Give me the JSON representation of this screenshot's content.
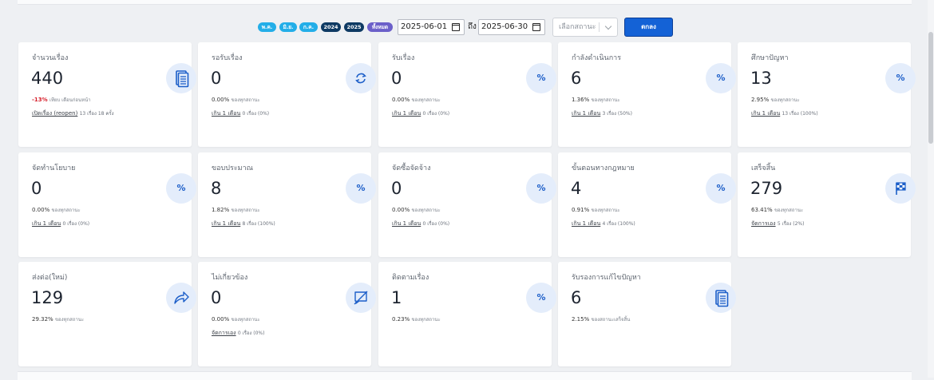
{
  "filters": {
    "pills": [
      {
        "label": "พ.ค.",
        "color": "#23aee8"
      },
      {
        "label": "มิ.ย.",
        "color": "#23aee8"
      },
      {
        "label": "ก.ค.",
        "color": "#23aee8"
      },
      {
        "label": "2024",
        "color": "#0e3a63"
      },
      {
        "label": "2025",
        "color": "#0e3a63"
      },
      {
        "label": "ทั้งหมด",
        "color": "#6b5fc9"
      }
    ],
    "start_date": "2025-06-01",
    "to_label": "ถึง",
    "end_date": "2025-06-30",
    "status_placeholder": "เลือกสถานะ",
    "ok_label": "ตกลง"
  },
  "cards": [
    {
      "title": "จำนวนเรื่อง",
      "value": "440",
      "icon": "document-stack-icon",
      "sub_value": "-13%",
      "sub_text": "เทียบ เดือนก่อนหน้า",
      "link_label": "เปิดเรื่อง (reopen)",
      "link_text": "13 เรื่อง 18 ครั้ง"
    },
    {
      "title": "รอรับเรื่อง",
      "value": "0",
      "icon": "refresh-icon",
      "sub_value": "0.00%",
      "sub_text": "ของทุกสถานะ",
      "link_label": "เกิน 1 เดือน",
      "link_text": "0 เรื่อง (0%)"
    },
    {
      "title": "รับเรื่อง",
      "value": "0",
      "icon": "percent-icon",
      "icon_text": "%",
      "sub_value": "0.00%",
      "sub_text": "ของทุกสถานะ",
      "link_label": "เกิน 1 เดือน",
      "link_text": "0 เรื่อง (0%)"
    },
    {
      "title": "กำลังดำเนินการ",
      "value": "6",
      "icon": "percent-icon",
      "icon_text": "%",
      "sub_value": "1.36%",
      "sub_text": "ของทุกสถานะ",
      "link_label": "เกิน 1 เดือน",
      "link_text": "3 เรื่อง (50%)"
    },
    {
      "title": "ศึกษาปัญหา",
      "value": "13",
      "icon": "percent-icon",
      "icon_text": "%",
      "sub_value": "2.95%",
      "sub_text": "ของทุกสถานะ",
      "link_label": "เกิน 1 เดือน",
      "link_text": "13 เรื่อง (100%)"
    },
    {
      "title": "จัดทำนโยบาย",
      "value": "0",
      "icon": "percent-icon",
      "icon_text": "%",
      "sub_value": "0.00%",
      "sub_text": "ของทุกสถานะ",
      "link_label": "เกิน 1 เดือน",
      "link_text": "0 เรื่อง (0%)"
    },
    {
      "title": "ขอบประมาณ",
      "value": "8",
      "icon": "percent-icon",
      "icon_text": "%",
      "sub_value": "1.82%",
      "sub_text": "ของทุกสถานะ",
      "link_label": "เกิน 1 เดือน",
      "link_text": "8 เรื่อง (100%)"
    },
    {
      "title": "จัดซื้อจัดจ้าง",
      "value": "0",
      "icon": "percent-icon",
      "icon_text": "%",
      "sub_value": "0.00%",
      "sub_text": "ของทุกสถานะ",
      "link_label": "เกิน 1 เดือน",
      "link_text": "0 เรื่อง (0%)"
    },
    {
      "title": "ขั้นตอนทางกฎหมาย",
      "value": "4",
      "icon": "percent-icon",
      "icon_text": "%",
      "sub_value": "0.91%",
      "sub_text": "ของทุกสถานะ",
      "link_label": "เกิน 1 เดือน",
      "link_text": "4 เรื่อง (100%)"
    },
    {
      "title": "เสร็จสิ้น",
      "value": "279",
      "icon": "checkered-flag-icon",
      "sub_value": "63.41%",
      "sub_text": "ของทุกสถานะ",
      "link_label": "จัดการเอง",
      "link_text": "5 เรื่อง (2%)"
    },
    {
      "title": "ส่งต่อ(ใหม่)",
      "value": "129",
      "icon": "share-arrow-icon",
      "sub_value": "29.32%",
      "sub_text": "ของทุกสถานะ"
    },
    {
      "title": "ไม่เกี่ยวข้อง",
      "value": "0",
      "icon": "no-comment-icon",
      "sub_value": "0.00%",
      "sub_text": "ของทุกสถานะ",
      "link_label": "จัดการเอง",
      "link_text": "0 เรื่อง (0%)"
    },
    {
      "title": "ติดตามเรื่อง",
      "value": "1",
      "icon": "percent-icon",
      "icon_text": "%",
      "sub_value": "0.23%",
      "sub_text": "ของทุกสถานะ"
    },
    {
      "title": "รับรองการแก้ไขปัญหา",
      "value": "6",
      "icon": "document-stack-icon",
      "sub_value": "2.15%",
      "sub_text": "ของสถานะเสร็จสิ้น"
    }
  ]
}
